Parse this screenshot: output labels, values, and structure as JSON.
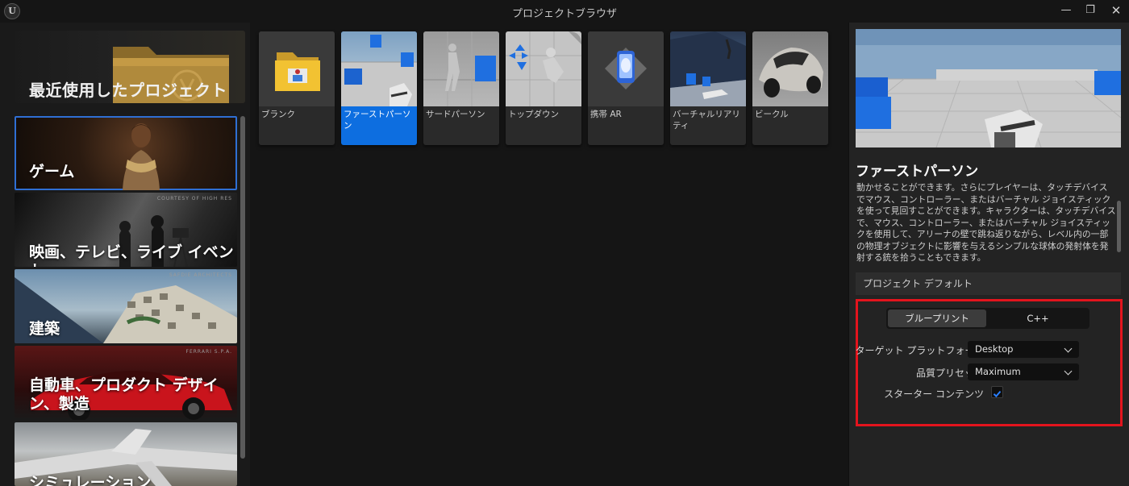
{
  "window": {
    "logo_text": "U",
    "title": "プロジェクトブラウザ",
    "minimize_icon": "minimize-icon",
    "restore_icon": "restore-icon",
    "close_icon": "close-icon"
  },
  "sidebar": {
    "recent_label": "最近使用したプロジェクト",
    "categories": [
      {
        "label": "ゲーム",
        "credit": "",
        "selected": true
      },
      {
        "label": "映画、テレビ、ライブ イベント",
        "credit": "COURTESY OF HIGH RES",
        "selected": false
      },
      {
        "label": "建築",
        "credit": "SAFDIE ARCHITECTS",
        "selected": false
      },
      {
        "label": "自動車、プロダクト デザイン、製造",
        "credit": "FERRARI S.P.A.",
        "selected": false
      },
      {
        "label": "シミュレーション",
        "credit": "",
        "selected": false
      }
    ]
  },
  "templates": [
    {
      "label": "ブランク",
      "selected": false
    },
    {
      "label": "ファーストパーソン",
      "selected": true
    },
    {
      "label": "サードパーソン",
      "selected": false
    },
    {
      "label": "トップダウン",
      "selected": false
    },
    {
      "label": "携帯 AR",
      "selected": false
    },
    {
      "label": "バーチャルリアリティ",
      "selected": false
    },
    {
      "label": "ビークル",
      "selected": false
    }
  ],
  "details": {
    "title": "ファーストパーソン",
    "description": "動かせることができます。さらにプレイヤーは、タッチデバイスでマウス、コントローラー、またはバーチャル ジョイスティックを使って見回すことができます。キャラクターは、タッチデバイスで、マウス、コントローラー、またはバーチャル ジョイスティックを使用して、アリーナの壁で跳ね返りながら、レベル内の一部の物理オブジェクトに影響を与えるシンプルな球体の発射体を発射する銃を拾うこともできます。",
    "defaults_header": "プロジェクト デフォルト",
    "language": {
      "blueprint": "ブループリント",
      "cpp": "C++",
      "selected": "ブループリント"
    },
    "target_platform": {
      "label": "ターゲット プラットフォーム",
      "value": "Desktop"
    },
    "quality_preset": {
      "label": "品質プリセット",
      "value": "Maximum"
    },
    "starter_content": {
      "label": "スターター コンテンツ",
      "checked": true
    }
  },
  "colors": {
    "accent_blue": "#0d6ee0",
    "highlight_red": "#e3141d",
    "panel": "#232323",
    "background": "#151515"
  }
}
